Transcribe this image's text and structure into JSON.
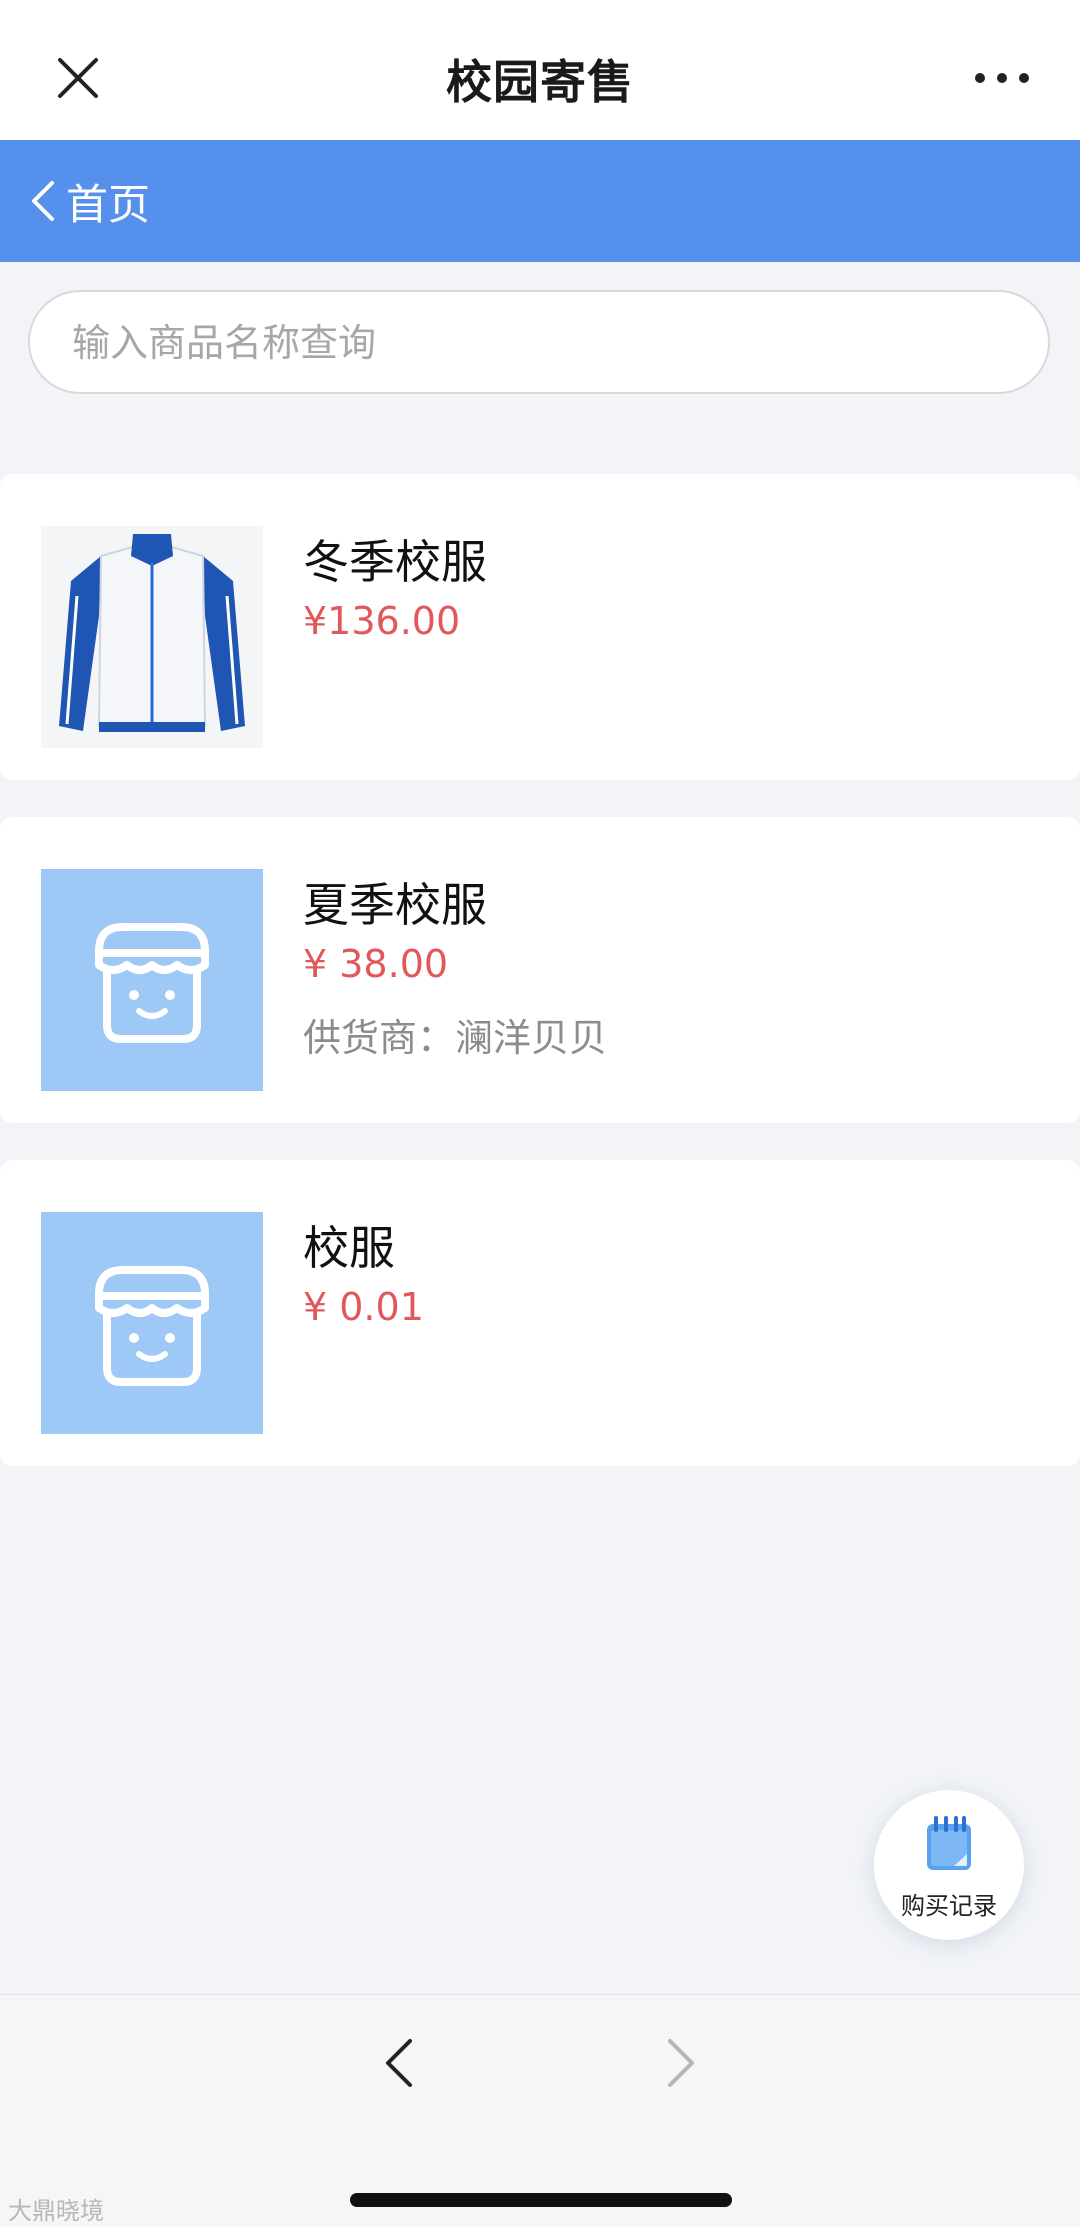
{
  "header": {
    "title": "校园寄售",
    "close_icon": "close-icon",
    "more_icon": "more-dots-icon"
  },
  "nav": {
    "back_label": "首页",
    "back_icon": "chevron-left-icon",
    "bg_color": "#5590ED"
  },
  "search": {
    "placeholder": "输入商品名称查询",
    "value": ""
  },
  "products": [
    {
      "name": "冬季校服",
      "price": "¥136.00",
      "image": "jacket-photo"
    },
    {
      "name": "夏季校服",
      "price": "¥ 38.00",
      "supplier": "供货商：澜洋贝贝",
      "image": "shop-placeholder-icon"
    },
    {
      "name": "校服",
      "price": "¥ 0.01",
      "image": "shop-placeholder-icon"
    }
  ],
  "fab": {
    "label": "购买记录",
    "icon": "notebook-icon"
  },
  "bottom_nav": {
    "back_icon": "chevron-left-icon",
    "forward_icon": "chevron-right-icon"
  },
  "watermark": "大鼎晓境",
  "colors": {
    "price": "#E0585A",
    "accent": "#5590ED",
    "placeholder_tile": "#9EC8F6"
  }
}
